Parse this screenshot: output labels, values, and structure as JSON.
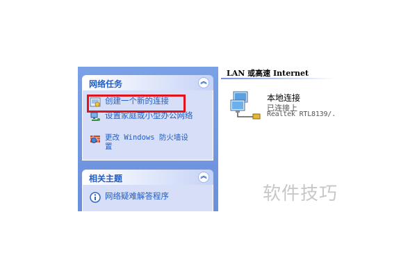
{
  "network_tasks": {
    "title": "网络任务",
    "items": [
      {
        "label": "创建一个新的连接",
        "icon": "new-connection-icon"
      },
      {
        "label": "设置家庭或小型办公网络",
        "icon": "home-network-icon"
      },
      {
        "label": "更改 Windows 防火墙设置",
        "icon": "firewall-icon"
      }
    ]
  },
  "related_topics": {
    "title": "相关主题",
    "items": [
      {
        "label": "网络疑难解答程序",
        "icon": "info-icon"
      }
    ]
  },
  "content": {
    "section_title": "LAN 或高速 Internet",
    "connection": {
      "name": "本地连接",
      "status": "已连接上",
      "device": "Realtek RTL8139/.",
      "icon": "network-connection-icon"
    }
  },
  "watermark": "软件技巧",
  "colors": {
    "task_link": "#215dc6",
    "highlight": "#e0141a",
    "pane_blue": "#7aa1e6"
  }
}
